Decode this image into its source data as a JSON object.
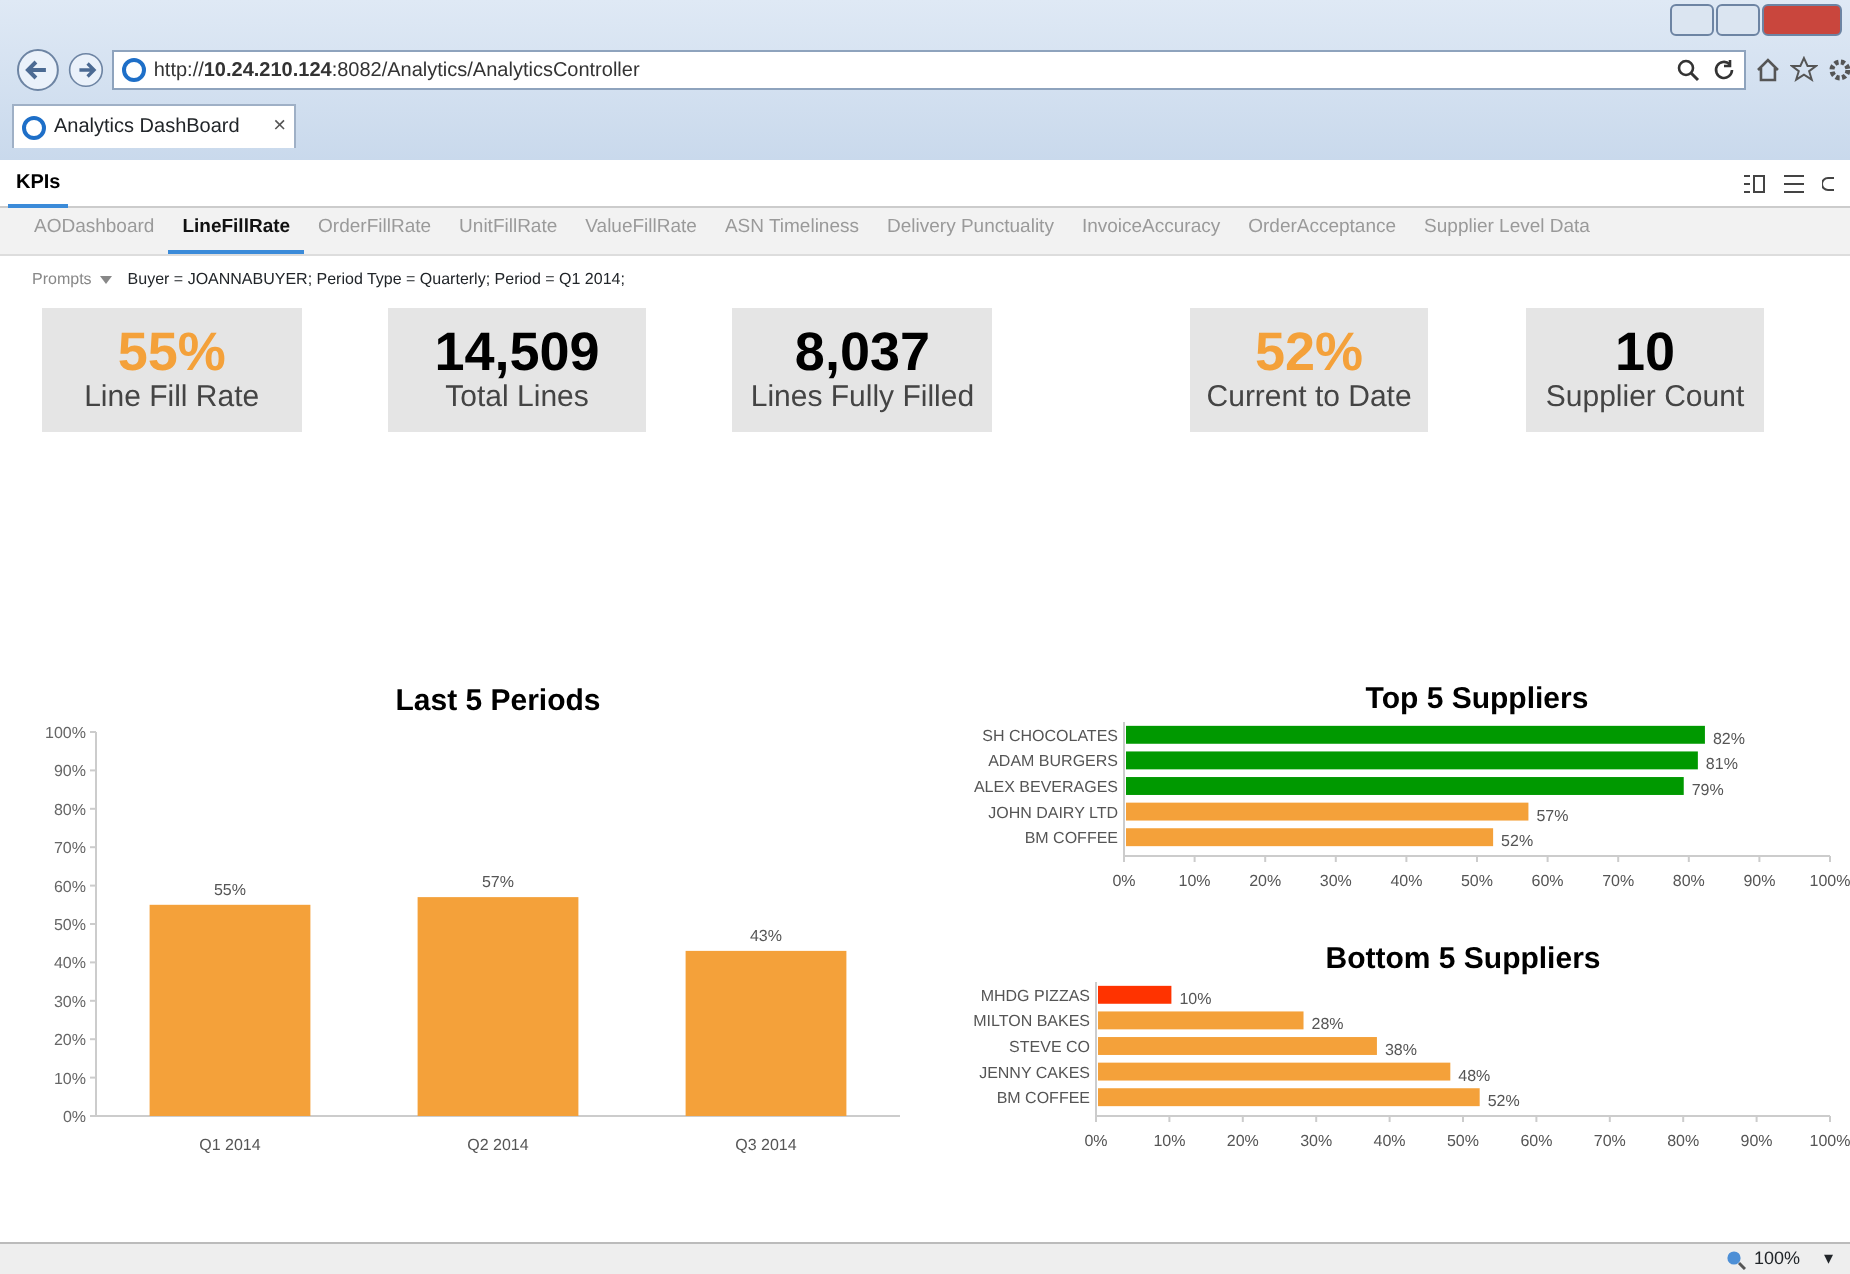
{
  "browser": {
    "address": "http://**10.24.210.124**:8082/Analytics/AnalyticsController",
    "tab_title": "Analytics DashBoard",
    "tab_close": "×"
  },
  "app": {
    "title": "KPIs"
  },
  "tabs": [
    {
      "label": "AODashboard",
      "selected": false
    },
    {
      "label": "LineFillRate",
      "selected": true
    },
    {
      "label": "OrderFillRate",
      "selected": false
    },
    {
      "label": "UnitFillRate",
      "selected": false
    },
    {
      "label": "ValueFillRate",
      "selected": false
    },
    {
      "label": "ASN Timeliness",
      "selected": false
    },
    {
      "label": "Delivery Punctuality",
      "selected": false
    },
    {
      "label": "InvoiceAccuracy",
      "selected": false
    },
    {
      "label": "OrderAcceptance",
      "selected": false
    },
    {
      "label": "Supplier Level Data",
      "selected": false
    }
  ],
  "prompts": {
    "label": "Prompts",
    "text": "Buyer = JOANNABUYER; Period Type = Quarterly; Period = Q1 2014;"
  },
  "kpis": [
    {
      "value": "55%",
      "label": "Line Fill Rate",
      "color": "#f4a13a"
    },
    {
      "value": "14,509",
      "label": "Total Lines",
      "color": "#000000"
    },
    {
      "value": "8,037",
      "label": "Lines Fully Filled",
      "color": "#000000"
    },
    {
      "value": "52%",
      "label": "Current to Date",
      "color": "#f4a13a"
    },
    {
      "value": "10",
      "label": "Supplier Count",
      "color": "#000000"
    }
  ],
  "charts": [
    {
      "chart_data": {
        "type": "bar",
        "orientation": "vertical",
        "title": "Last 5 Periods",
        "categories": [
          "Q1 2014",
          "Q2 2014",
          "Q3 2014"
        ],
        "series": [
          {
            "color": "#f4a13a",
            "values": [
              55,
              57,
              43
            ]
          }
        ],
        "ylim": [
          0,
          100
        ],
        "yticks": [
          {
            "value": 0,
            "label": "0%"
          },
          {
            "value": 10,
            "label": "10%"
          },
          {
            "value": 20,
            "label": "20%"
          },
          {
            "value": 30,
            "label": "30%"
          },
          {
            "value": 40,
            "label": "40%"
          },
          {
            "value": 50,
            "label": "50%"
          },
          {
            "value": 60,
            "label": "60%"
          },
          {
            "value": 70,
            "label": "70%"
          },
          {
            "value": 80,
            "label": "80%"
          },
          {
            "value": 90,
            "label": "90%"
          },
          {
            "value": 100,
            "label": "100%"
          }
        ],
        "value_labels": [
          "55%",
          "57%",
          "43%"
        ]
      }
    },
    {
      "chart_data": {
        "type": "bar",
        "orientation": "horizontal",
        "title": "Top 5 Suppliers",
        "categories": [
          "SH CHOCOLATES",
          "ADAM BURGERS",
          "ALEX BEVERAGES",
          "JOHN DAIRY LTD",
          "BM COFFEE"
        ],
        "series": [
          {
            "color": "#009900",
            "values": [
              82,
              81,
              79,
              null,
              null
            ]
          },
          {
            "color": "#f4a13a",
            "values": [
              null,
              null,
              null,
              57,
              52
            ]
          }
        ],
        "xlim": [
          0,
          100
        ],
        "xticks": [
          {
            "value": 0,
            "label": "0%"
          },
          {
            "value": 10,
            "label": "10%"
          },
          {
            "value": 20,
            "label": "20%"
          },
          {
            "value": 30,
            "label": "30%"
          },
          {
            "value": 40,
            "label": "40%"
          },
          {
            "value": 50,
            "label": "50%"
          },
          {
            "value": 60,
            "label": "60%"
          },
          {
            "value": 70,
            "label": "70%"
          },
          {
            "value": 80,
            "label": "80%"
          },
          {
            "value": 90,
            "label": "90%"
          },
          {
            "value": 100,
            "label": "100%"
          }
        ],
        "value_labels": [
          "82%",
          "81%",
          "79%",
          "57%",
          "52%"
        ]
      }
    },
    {
      "chart_data": {
        "type": "bar",
        "orientation": "horizontal",
        "title": "Bottom 5 Suppliers",
        "categories": [
          "MHDG PIZZAS",
          "MILTON BAKES",
          "STEVE CO",
          "JENNY CAKES",
          "BM COFFEE"
        ],
        "series": [
          {
            "color": "#ff3300",
            "values": [
              10,
              null,
              null,
              null,
              null
            ]
          },
          {
            "color": "#f4a13a",
            "values": [
              null,
              28,
              38,
              48,
              52
            ]
          }
        ],
        "xlim": [
          0,
          100
        ],
        "xticks": [
          {
            "value": 0,
            "label": "0%"
          },
          {
            "value": 10,
            "label": "10%"
          },
          {
            "value": 20,
            "label": "20%"
          },
          {
            "value": 30,
            "label": "30%"
          },
          {
            "value": 40,
            "label": "40%"
          },
          {
            "value": 50,
            "label": "50%"
          },
          {
            "value": 60,
            "label": "60%"
          },
          {
            "value": 70,
            "label": "70%"
          },
          {
            "value": 80,
            "label": "80%"
          },
          {
            "value": 90,
            "label": "90%"
          },
          {
            "value": 100,
            "label": "100%"
          }
        ],
        "value_labels": [
          "10%",
          "28%",
          "38%",
          "48%",
          "52%"
        ]
      }
    }
  ],
  "status_bar": {
    "zoom": "100%",
    "zoom_caret": "▾"
  }
}
